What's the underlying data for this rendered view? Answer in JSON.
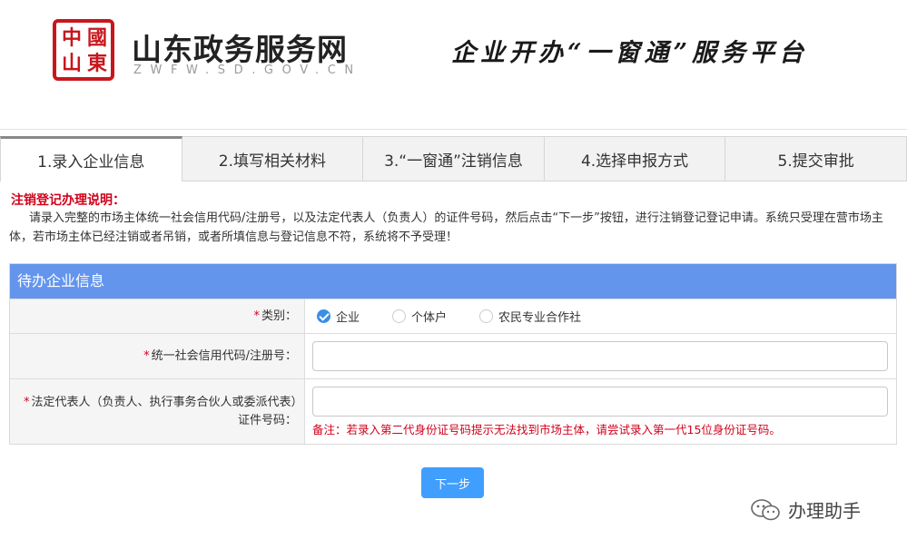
{
  "header": {
    "seal_chars": [
      "中",
      "國",
      "山",
      "東"
    ],
    "site_name": "山东政务服务网",
    "site_domain": "ZWFW.SD.GOV.CN",
    "slogan": "企业开办“一窗通”服务平台"
  },
  "tabs": [
    {
      "label": "1.录入企业信息",
      "active": true
    },
    {
      "label": "2.填写相关材料",
      "active": false
    },
    {
      "label": "3.“一窗通”注销信息",
      "active": false
    },
    {
      "label": "4.选择申报方式",
      "active": false
    },
    {
      "label": "5.提交审批",
      "active": false
    }
  ],
  "notice": {
    "title": "注销登记办理说明：",
    "body": "请录入完整的市场主体统一社会信用代码/注册号，以及法定代表人（负责人）的证件号码，然后点击“下一步”按钮，进行注销登记登记申请。系统只受理在营市场主体，若市场主体已经注销或者吊销，或者所填信息与登记信息不符，系统将不予受理！"
  },
  "form": {
    "panel_title": "待办企业信息",
    "required_mark": "*",
    "type": {
      "label": "类别：",
      "options": [
        {
          "label": "企业",
          "checked": true
        },
        {
          "label": "个体户",
          "checked": false
        },
        {
          "label": "农民专业合作社",
          "checked": false
        }
      ]
    },
    "credit_code": {
      "label": "统一社会信用代码/注册号：",
      "value": "",
      "placeholder": ""
    },
    "legal_rep_id": {
      "label": "法定代表人（负责人、执行事务合伙人或委派代表）证件号码：",
      "value": "",
      "placeholder": "",
      "hint": "备注：若录入第二代身份证号码提示无法找到市场主体，请尝试录入第一代15位身份证号码。"
    }
  },
  "actions": {
    "next_label": "下一步"
  },
  "watermark": {
    "text": "办理助手"
  },
  "colors": {
    "brand_red": "#c8161d",
    "panel_blue": "#6495ed",
    "button_blue": "#409eff",
    "alert_red": "#d0021b"
  }
}
